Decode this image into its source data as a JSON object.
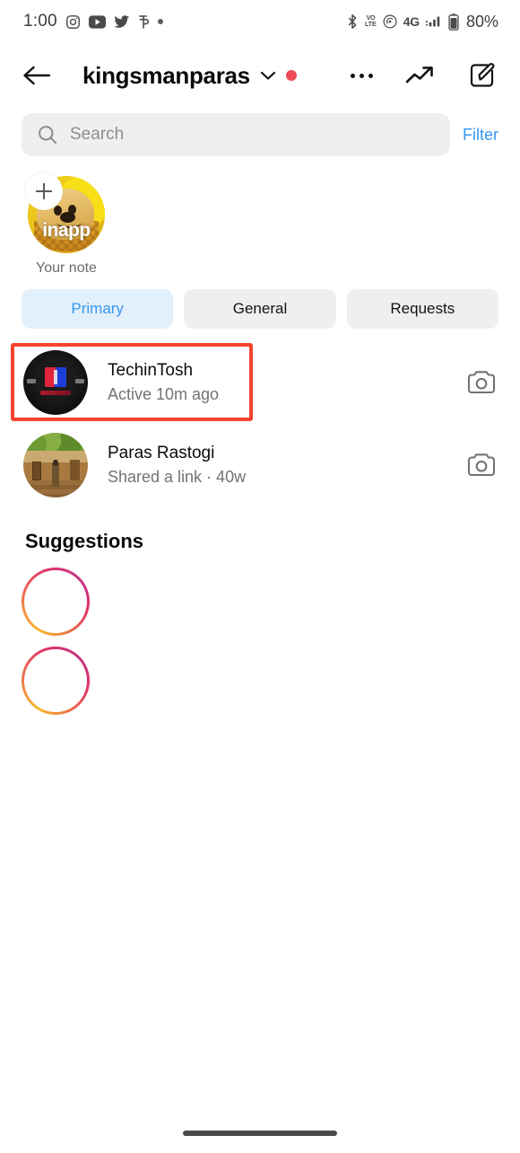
{
  "status_bar": {
    "time": "1:00",
    "left_icons": [
      "instagram-icon",
      "youtube-icon",
      "twitter-icon",
      "phonepe-icon",
      "dot-indicator"
    ],
    "bluetooth": "bluetooth-icon",
    "volte_line1": "VO",
    "volte_line2": "LTE",
    "hotspot": "hotspot-icon",
    "network_type": "4G",
    "signal": "signal-bars-icon",
    "battery_text": "80%"
  },
  "header": {
    "back": "back-arrow-icon",
    "title": "kingsmanparas",
    "chevron": "chevron-down-icon",
    "has_unread_dot": true,
    "unread_dot_color": "#ed4956",
    "more": "more-options-icon",
    "trending": "trending-up-icon",
    "compose": "compose-icon"
  },
  "search": {
    "placeholder": "Search",
    "icon": "search-icon",
    "filter_label": "Filter",
    "filter_color": "#3897f0"
  },
  "note": {
    "avatar_text": "inapp",
    "label": "Your note",
    "add_badge": "plus-icon"
  },
  "tabs": [
    {
      "label": "Primary",
      "active": true
    },
    {
      "label": "General",
      "active": false
    },
    {
      "label": "Requests",
      "active": false
    }
  ],
  "chats": [
    {
      "name": "TechinTosh",
      "subtitle": "Active 10m ago",
      "camera": "camera-icon",
      "highlighted": true,
      "highlight_color": "#f5442e"
    },
    {
      "name": "Paras Rastogi",
      "subtitle": "Shared a link · 40w",
      "camera": "camera-icon",
      "highlighted": false
    }
  ],
  "suggestions": {
    "title": "Suggestions",
    "items": [
      {
        "ring": "story-ring-gradient"
      },
      {
        "ring": "story-ring-gradient"
      }
    ]
  },
  "nav": {
    "pill": "home-gesture-pill"
  }
}
